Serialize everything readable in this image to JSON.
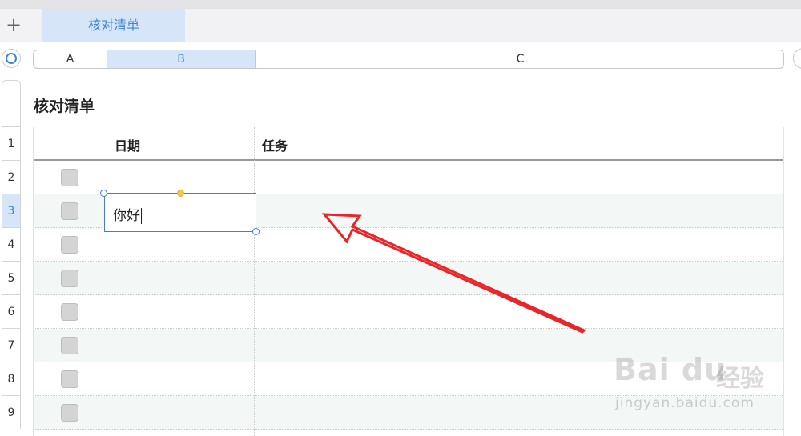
{
  "sheet_tab": {
    "label": "核对清单",
    "add_icon": "plus-icon"
  },
  "columns": {
    "a": "A",
    "b": "B",
    "c": "C"
  },
  "rows": [
    "1",
    "2",
    "3",
    "4",
    "5",
    "6",
    "7",
    "8",
    "9"
  ],
  "table": {
    "title": "核对清单",
    "header": {
      "date": "日期",
      "task": "任务"
    },
    "editing_value": "你好"
  },
  "watermark": {
    "logo": "Bai du",
    "cn": "经验",
    "url": "jingyan.baidu.com"
  },
  "colors": {
    "accent": "#3d86d6",
    "selection": "#d6e6f8",
    "arrow": "#e8262a"
  }
}
